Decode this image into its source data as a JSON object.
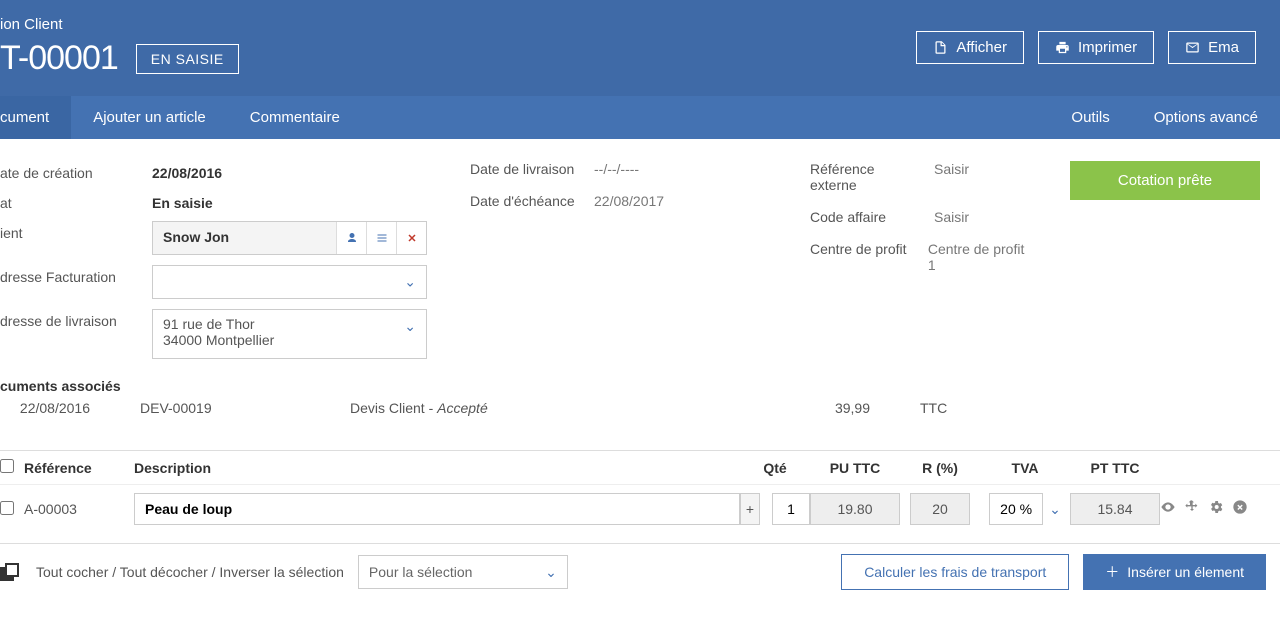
{
  "header": {
    "subtitle": "ion Client",
    "doc_number": "T-00001",
    "status_badge": "EN SAISIE",
    "actions": {
      "display": "Afficher",
      "print": "Imprimer",
      "email": "Ema"
    }
  },
  "nav": {
    "document": "cument",
    "add_article": "Ajouter un article",
    "comment": "Commentaire",
    "tools": "Outils",
    "advanced": "Options avancé"
  },
  "form": {
    "labels": {
      "created": "ate de création",
      "state": "at",
      "client": "ient",
      "billing": "dresse Facturation",
      "shipping": "dresse de livraison",
      "delivery_date": "Date de livraison",
      "due_date": "Date d'échéance",
      "ext_ref": "Référence externe",
      "deal_code": "Code affaire",
      "profit_center": "Centre de profit"
    },
    "values": {
      "created": "22/08/2016",
      "state": "En saisie",
      "client_name": "Snow Jon",
      "shipping_addr": "91 rue de Thor\n34000 Montpellier",
      "delivery_date": "--/--/----",
      "due_date": "22/08/2017",
      "ext_ref_placeholder": "Saisir",
      "deal_code_placeholder": "Saisir",
      "profit_center": "Centre de profit 1",
      "ready_cta": "Cotation prête"
    }
  },
  "linked_docs": {
    "title": "cuments associés",
    "row": {
      "date": "22/08/2016",
      "ref": "DEV-00019",
      "type_prefix": "Devis Client - ",
      "type_status": "Accepté",
      "amount": "39,99",
      "ttc": "TTC"
    }
  },
  "items": {
    "headers": {
      "ref": "Référence",
      "desc": "Description",
      "qty": "Qté",
      "pu": "PU TTC",
      "r": "R (%)",
      "tva": "TVA",
      "pt": "PT TTC"
    },
    "row": {
      "ref": "A-00003",
      "desc": "Peau de loup",
      "qty": "1",
      "pu": "19.80",
      "r": "20",
      "tva": "20 %",
      "pt": "15.84"
    }
  },
  "footer": {
    "check_text": "Tout cocher / Tout décocher / Inverser la sélection",
    "selection_label": "Pour la sélection",
    "calc_shipping": "Calculer les frais de transport",
    "insert": "Insérer un élement"
  }
}
